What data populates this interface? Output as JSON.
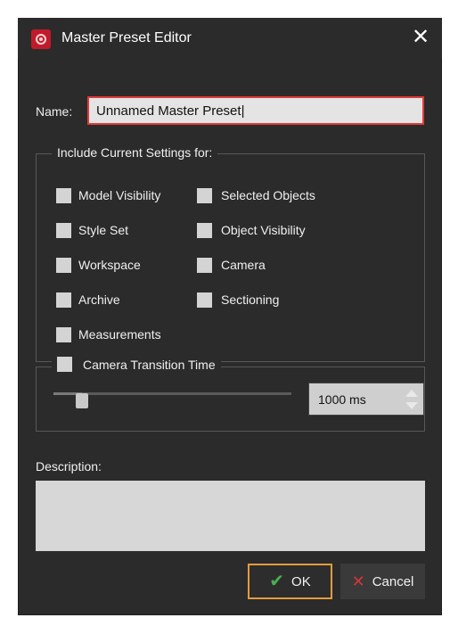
{
  "window": {
    "title": "Master Preset Editor",
    "close_label": "✕",
    "app_icon": "app-icon-red-target"
  },
  "name": {
    "label": "Name:",
    "value": "Unnamed Master Preset|",
    "input_border_color": "#e23a3a"
  },
  "include": {
    "title": "Include Current Settings for:",
    "left_items": [
      "Model Visibility",
      "Style Set",
      "Workspace",
      "Archive",
      "Measurements"
    ],
    "right_items": [
      "Selected Objects",
      "Object Visibility",
      "Camera",
      "Sectioning"
    ]
  },
  "camera_transition": {
    "title": "Camera Transition Time",
    "slider_value_fraction": 0.12,
    "value": "1000 ms"
  },
  "description": {
    "label": "Description:"
  },
  "buttons": {
    "ok": "OK",
    "cancel": "Cancel"
  },
  "colors": {
    "dialog_bg": "#2b2b2b",
    "ok_border": "#e29b3e",
    "ok_icon": "#4caf50",
    "cancel_icon": "#d23737"
  }
}
